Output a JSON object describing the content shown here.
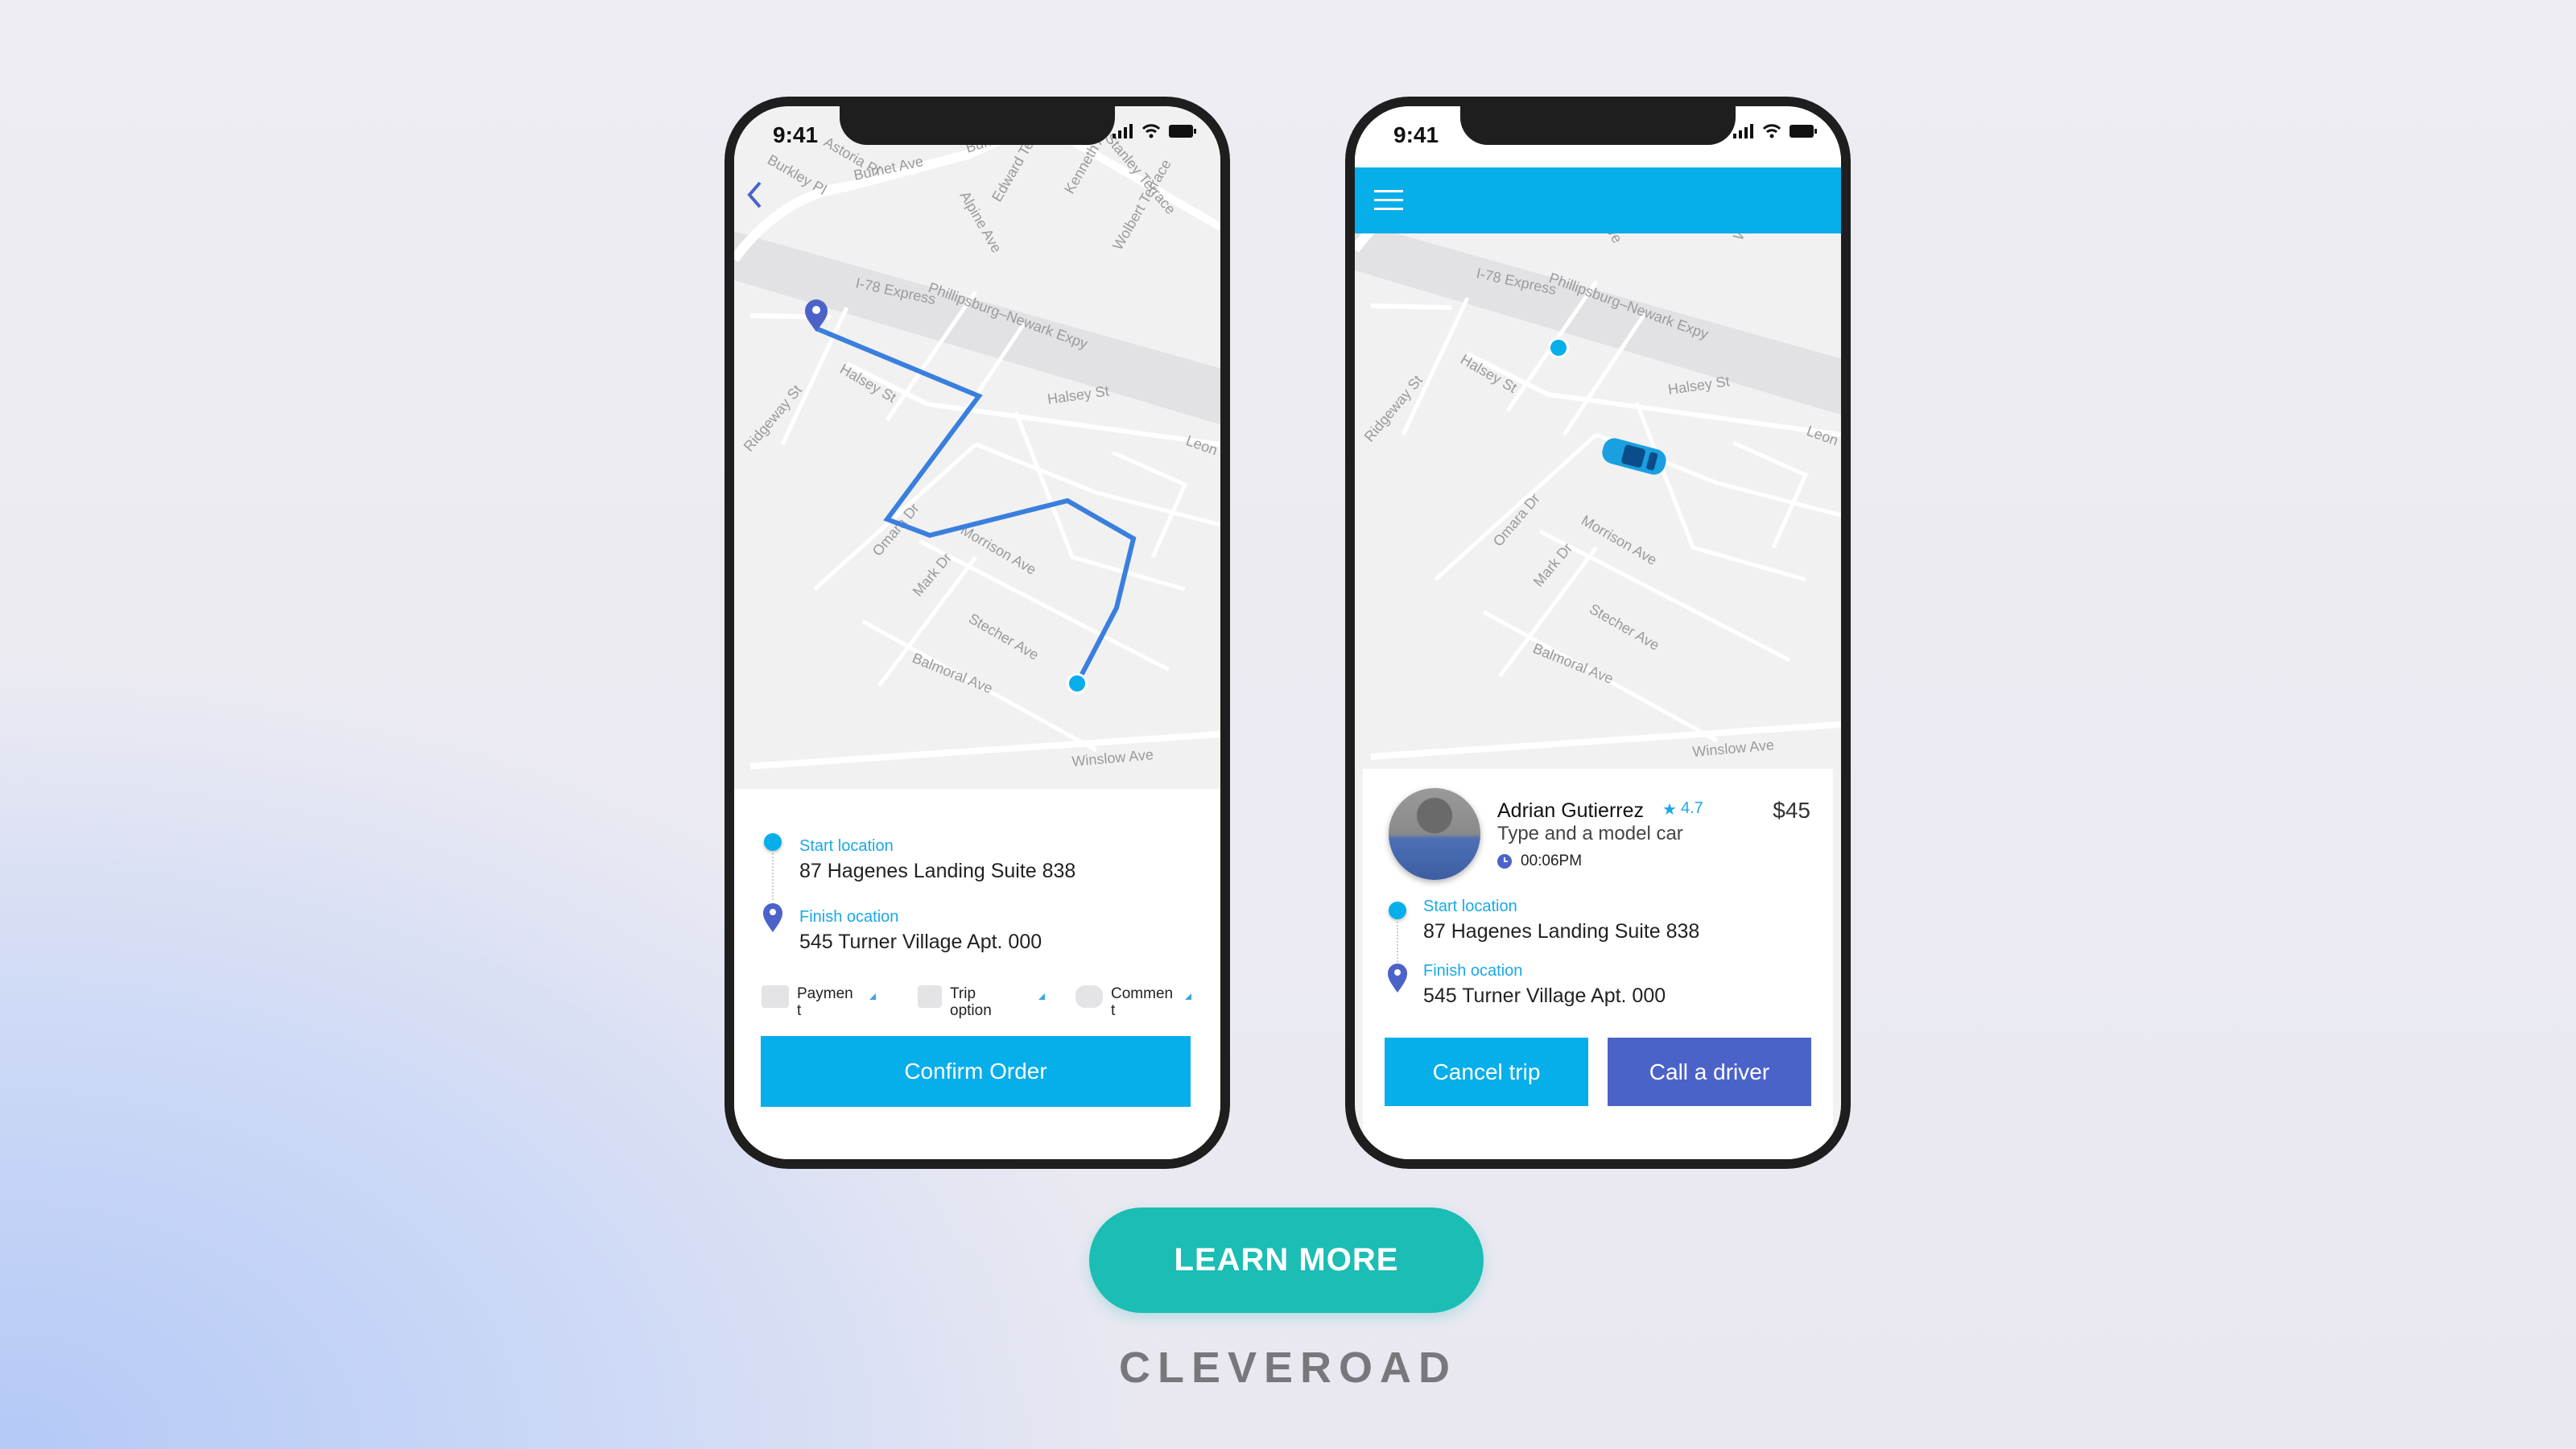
{
  "status_bar": {
    "time": "9:41"
  },
  "map": {
    "labels": [
      "Burnet Ave",
      "Burnet Ave",
      "Astoria Pl",
      "Burkley Pl",
      "Alpine Ave",
      "Edward Terrace",
      "Kenneth Ave",
      "Stanley Terrace",
      "Wolbert Terrace",
      "I-78 Express",
      "Phillipsburg–Newark Expy",
      "Halsey St",
      "Halsey St",
      "Ridgeway St",
      "Omara Dr",
      "Morrison Ave",
      "Mark Dr",
      "Stecher Ave",
      "Balmoral Ave",
      "Winslow Ave",
      "Leon"
    ]
  },
  "order_screen": {
    "start_label": "Start location",
    "start_address": "87 Hagenes Landing Suite 838",
    "finish_label": "Finish ocation",
    "finish_address": "545 Turner Village Apt. 000",
    "options": [
      {
        "label": "Paymen\nt",
        "icon": "credit-card-icon"
      },
      {
        "label": "Trip\noption",
        "icon": "luggage-icon"
      },
      {
        "label": "Commen\nt",
        "icon": "chat-bubble-icon"
      }
    ],
    "confirm_label": "Confirm Order"
  },
  "driver_screen": {
    "driver_name": "Adrian Gutierrez",
    "rating": "4.7",
    "car": "Type and a model car",
    "eta": "00:06PM",
    "price": "$45",
    "start_label": "Start location",
    "start_address": "87 Hagenes Landing Suite 838",
    "finish_label": "Finish ocation",
    "finish_address": "545 Turner Village Apt. 000",
    "cancel_label": "Cancel trip",
    "call_label": "Call a driver"
  },
  "cta": {
    "label": "LEARN MORE"
  },
  "brand": "CLEVEROAD",
  "colors": {
    "primary": "#06aeea",
    "secondary": "#4b63c9",
    "cta": "#1bbdb4",
    "route": "#3a7fde"
  }
}
